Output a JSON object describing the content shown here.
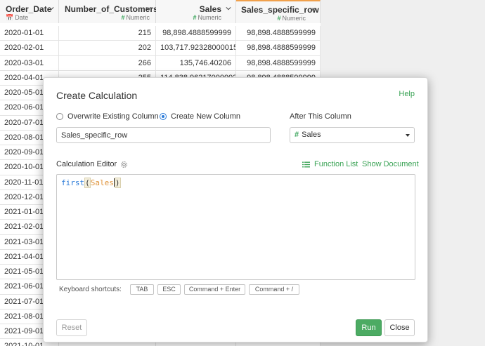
{
  "grid": {
    "columns": [
      {
        "name": "Order_Date",
        "type": "Date",
        "type_icon": "calendar-icon"
      },
      {
        "name": "Number_of_Customers",
        "type": "Numeric",
        "type_icon": "hash-icon"
      },
      {
        "name": "Sales",
        "type": "Numeric",
        "type_icon": "hash-icon"
      },
      {
        "name": "Sales_specific_row",
        "type": "Numeric",
        "type_icon": "hash-icon"
      }
    ],
    "rows": [
      [
        "2020-01-01",
        "215",
        "98,898.4888599999",
        "98,898.4888599999"
      ],
      [
        "2020-02-01",
        "202",
        "103,717.92328000015",
        "98,898.4888599999"
      ],
      [
        "2020-03-01",
        "266",
        "135,746.40206",
        "98,898.4888599999"
      ],
      [
        "2020-04-01",
        "255",
        "114,838.96217000002",
        "98,898.4888599999"
      ],
      [
        "2020-05-01",
        "",
        "",
        ""
      ],
      [
        "2020-06-01",
        "",
        "",
        ""
      ],
      [
        "2020-07-01",
        "",
        "",
        ""
      ],
      [
        "2020-08-01",
        "",
        "",
        ""
      ],
      [
        "2020-09-01",
        "",
        "",
        ""
      ],
      [
        "2020-10-01",
        "",
        "",
        ""
      ],
      [
        "2020-11-01",
        "",
        "",
        ""
      ],
      [
        "2020-12-01",
        "",
        "",
        ""
      ],
      [
        "2021-01-01",
        "",
        "",
        ""
      ],
      [
        "2021-02-01",
        "",
        "",
        ""
      ],
      [
        "2021-03-01",
        "",
        "",
        ""
      ],
      [
        "2021-04-01",
        "",
        "",
        ""
      ],
      [
        "2021-05-01",
        "",
        "",
        ""
      ],
      [
        "2021-06-01",
        "",
        "",
        ""
      ],
      [
        "2021-07-01",
        "",
        "",
        ""
      ],
      [
        "2021-08-01",
        "",
        "",
        ""
      ],
      [
        "2021-09-01",
        "",
        "",
        ""
      ],
      [
        "2021-10-01",
        "",
        "",
        ""
      ]
    ]
  },
  "dialog": {
    "title": "Create Calculation",
    "help": "Help",
    "radio_overwrite": "Overwrite Existing Column",
    "radio_new": "Create New Column",
    "selected_mode": "Create New Column",
    "after_label": "After This Column",
    "name_value": "Sales_specific_row",
    "after_value": "Sales",
    "editor_label": "Calculation Editor",
    "function_list": "Function List",
    "show_document": "Show Document",
    "code": {
      "fn": "first",
      "open": "(",
      "arg": "Sales",
      "close": ")"
    },
    "shortcuts_label": "Keyboard shortcuts:",
    "shortcuts": [
      "TAB",
      "ESC",
      "Command + Enter",
      "Command + /"
    ],
    "reset": "Reset",
    "run": "Run",
    "close": "Close"
  },
  "colors": {
    "accent_green": "#3aa355",
    "run_button": "#4cab63",
    "selected_column": "#f0a04b",
    "function_blue": "#2b7bd8",
    "column_orange": "#e0943b"
  }
}
